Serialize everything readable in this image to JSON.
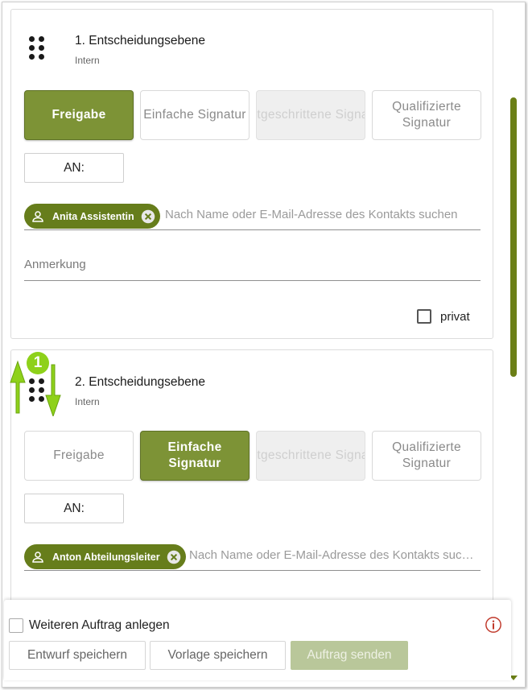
{
  "levels": [
    {
      "title": "1. Entscheidungsebene",
      "subtitle": "Intern",
      "signature_types": [
        {
          "label": "Freigabe",
          "state": "active"
        },
        {
          "label": "Einfache Signatur",
          "state": "normal"
        },
        {
          "label": "Fortgeschrittene Signatur",
          "state": "disabled"
        },
        {
          "label": "Qualifizierte Signatur",
          "state": "normal"
        }
      ],
      "recipient_button": "AN:",
      "recipient_chip": "Anita Assistentin",
      "search_placeholder": "Nach Name oder E-Mail-Adresse des Kontakts suchen",
      "note_placeholder": "Anmerkung",
      "private_label": "privat"
    },
    {
      "title": "2. Entscheidungsebene",
      "subtitle": "Intern",
      "signature_types": [
        {
          "label": "Freigabe",
          "state": "normal"
        },
        {
          "label": "Einfache Signatur",
          "state": "active"
        },
        {
          "label": "Fortgeschrittene Signatur",
          "state": "disabled"
        },
        {
          "label": "Qualifizierte Signatur",
          "state": "normal"
        }
      ],
      "recipient_button": "AN:",
      "recipient_chip": "Anton Abteilungsleiter",
      "search_placeholder": "Nach Name oder E-Mail-Adresse des Kontakts suchen"
    }
  ],
  "annotation": {
    "number": "1",
    "color": "#8ed11a"
  },
  "footer": {
    "another_order_label": "Weiteren Auftrag anlegen",
    "save_draft": "Entwurf speichern",
    "save_template": "Vorlage speichern",
    "send_order": "Auftrag senden"
  },
  "colors": {
    "accent": "#7d9336",
    "chip": "#667d1b",
    "scrollbar": "#6b7f16",
    "send_disabled": "#b9c79a",
    "info": "#c0392b"
  }
}
